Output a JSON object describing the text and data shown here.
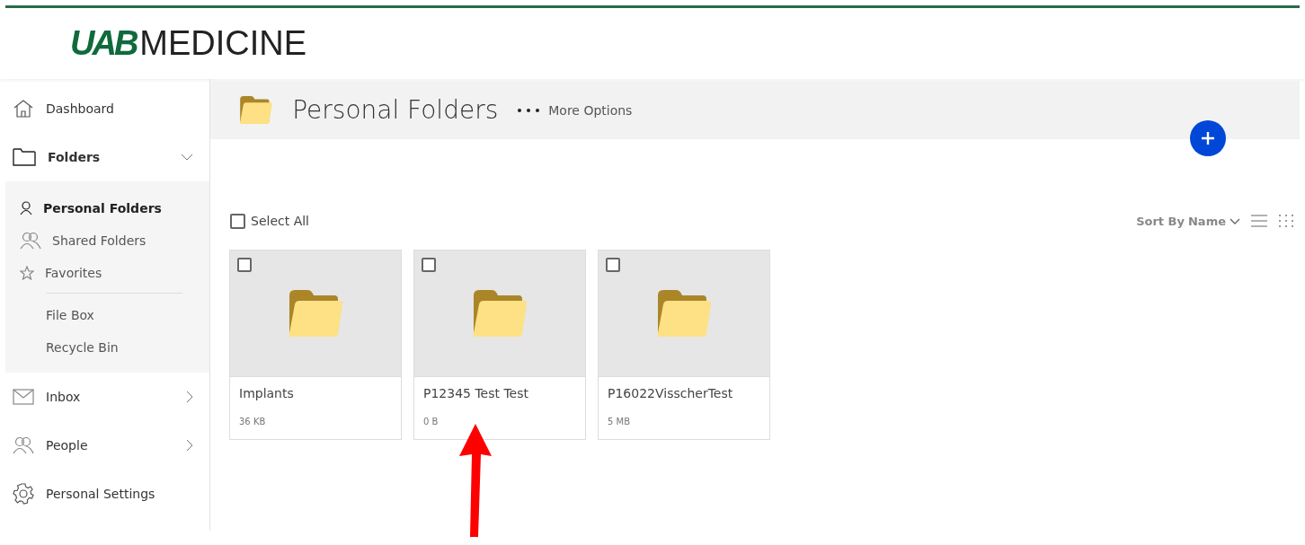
{
  "logo": {
    "mark": "UAB",
    "word": "MEDICINE"
  },
  "sidebar": {
    "items": [
      {
        "kind": "link",
        "label": "Dashboard",
        "selected": false
      },
      {
        "kind": "group",
        "label": "Folders",
        "expanded": true,
        "children": [
          {
            "kind": "icon_item",
            "label": "Personal Folders",
            "selected": true
          },
          {
            "kind": "icon_item",
            "label": "Shared Folders",
            "selected": false
          },
          {
            "kind": "icon_item",
            "label": "Favorites",
            "selected": false
          },
          {
            "kind": "divider"
          },
          {
            "kind": "plain",
            "label": "File Box",
            "selected": false
          },
          {
            "kind": "plain",
            "label": "Recycle Bin",
            "selected": false
          }
        ]
      },
      {
        "kind": "group",
        "label": "Inbox",
        "expanded": false
      },
      {
        "kind": "group",
        "label": "People",
        "expanded": false
      },
      {
        "kind": "link",
        "label": "Personal Settings",
        "selected": false
      }
    ]
  },
  "header": {
    "title": "Personal Folders",
    "more_options": "More Options"
  },
  "toolbar": {
    "select_all": {
      "label": "Select All",
      "checked": false
    },
    "sort_by": "Sort By",
    "sort_field": "Name"
  },
  "folders": [
    {
      "name": "Implants",
      "size": "36 KB",
      "checked": false
    },
    {
      "name": "P12345 Test Test",
      "size": "0 B",
      "checked": false
    },
    {
      "name": "P16022VisscherTest",
      "size": "5 MB",
      "checked": false
    }
  ]
}
